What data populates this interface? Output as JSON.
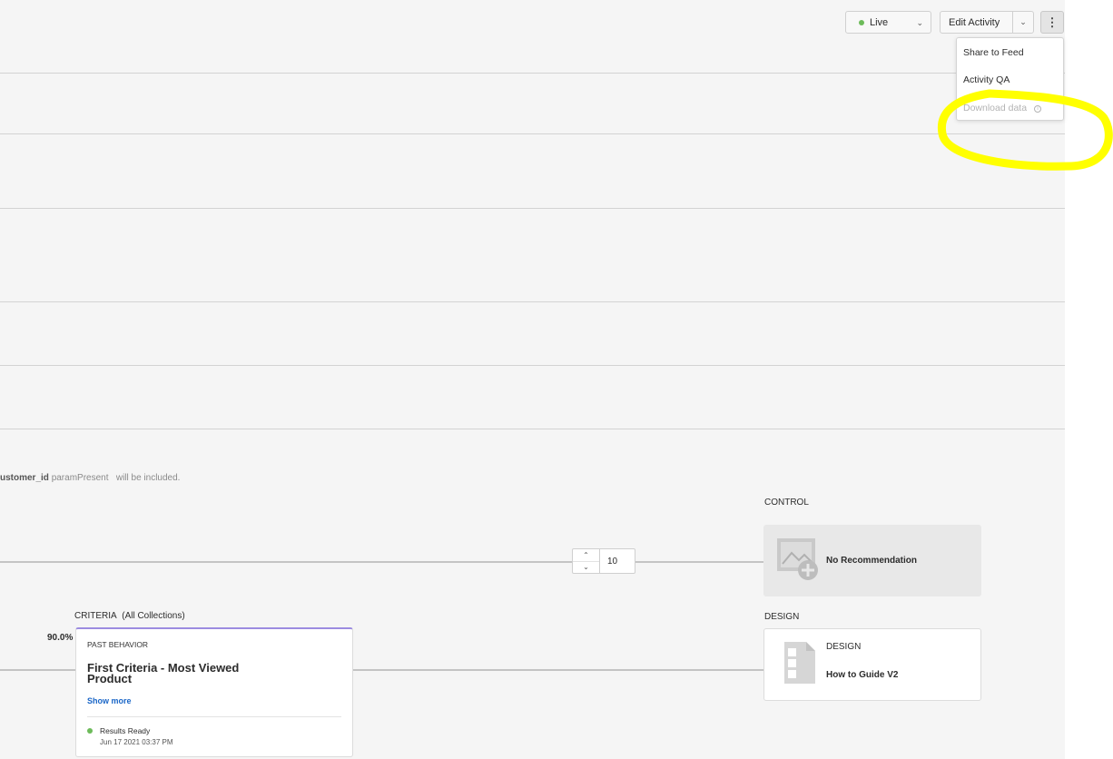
{
  "toolbar": {
    "status_label": "Live",
    "status_color": "#6dbb5a",
    "edit_label": "Edit Activity",
    "more_icon": "more-vertical-icon"
  },
  "menu": {
    "items": [
      {
        "label": "Share to Feed",
        "enabled": true
      },
      {
        "label": "Activity QA",
        "enabled": true
      },
      {
        "label": "Download data",
        "enabled": false
      }
    ]
  },
  "annotation": {
    "color": "#ffff00"
  },
  "audience_note": {
    "field": "ustomer_id",
    "condition": "paramPresent",
    "suffix": "will be included."
  },
  "traffic": {
    "control_label": "CONTROL",
    "control_card_title": "No Recommendation",
    "design_label": "DESIGN",
    "design_card_label": "DESIGN",
    "design_card_name": "How to Guide V2",
    "stepper_value": "10"
  },
  "criteria": {
    "header": "CRITERIA",
    "collection": "(All Collections)",
    "percent": "90.0%",
    "eyebrow": "PAST BEHAVIOR",
    "title": "First Criteria - Most Viewed Product",
    "show_more": "Show more",
    "status": "Results Ready",
    "date": "Jun 17 2021 03:37 PM",
    "accent_color": "#9c8ce0"
  }
}
